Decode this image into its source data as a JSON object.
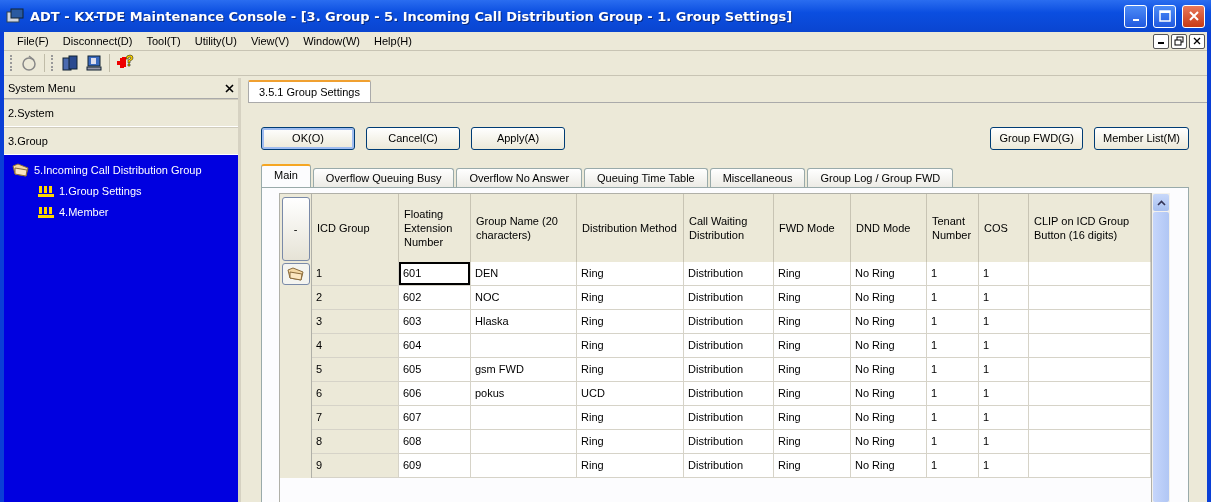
{
  "window": {
    "title": "ADT - KX-TDE Maintenance Console - [3. Group - 5. Incoming Call Distribution Group - 1. Group Settings]"
  },
  "menu": [
    "File(F)",
    "Disconnect(D)",
    "Tool(T)",
    "Utility(U)",
    "View(V)",
    "Window(W)",
    "Help(H)"
  ],
  "sidebar": {
    "title": "System Menu",
    "sections": [
      "2.System",
      "3.Group"
    ],
    "tree": [
      {
        "label": "5.Incoming Call Distribution Group",
        "children": [
          {
            "label": "1.Group Settings"
          },
          {
            "label": "4.Member"
          }
        ]
      }
    ]
  },
  "document_tab": {
    "label": "3.5.1 Group Settings",
    "selected": true
  },
  "buttons": [
    {
      "label": "OK(O)",
      "default": true
    },
    {
      "label": "Cancel(C)",
      "default": false
    },
    {
      "label": "Apply(A)",
      "default": false
    }
  ],
  "right_buttons": [
    "Group FWD(G)",
    "Member List(M)"
  ],
  "tabs": [
    {
      "label": "Main",
      "selected": true
    },
    {
      "label": "Overflow Queuing Busy",
      "selected": false
    },
    {
      "label": "Overflow No Answer",
      "selected": false
    },
    {
      "label": "Queuing Time Table",
      "selected": false
    },
    {
      "label": "Miscellaneous",
      "selected": false
    },
    {
      "label": "Group Log / Group FWD",
      "selected": false
    }
  ],
  "table": {
    "corner": "-",
    "columns": [
      "ICD Group",
      "Floating Extension Number",
      "Group Name (20 characters)",
      "Distribution Method",
      "Call Waiting Distribution",
      "FWD Mode",
      "DND Mode",
      "Tenant Number",
      "COS",
      "CLIP on ICD Group Button (16 digits)"
    ],
    "rows": [
      {
        "selected": true,
        "cells": [
          "1",
          "601",
          "DEN",
          "Ring",
          "Distribution",
          "Ring",
          "No Ring",
          "1",
          "1",
          ""
        ]
      },
      {
        "selected": false,
        "cells": [
          "2",
          "602",
          "NOC",
          "Ring",
          "Distribution",
          "Ring",
          "No Ring",
          "1",
          "1",
          ""
        ]
      },
      {
        "selected": false,
        "cells": [
          "3",
          "603",
          "Hlaska",
          "Ring",
          "Distribution",
          "Ring",
          "No Ring",
          "1",
          "1",
          ""
        ]
      },
      {
        "selected": false,
        "cells": [
          "4",
          "604",
          "",
          "Ring",
          "Distribution",
          "Ring",
          "No Ring",
          "1",
          "1",
          ""
        ]
      },
      {
        "selected": false,
        "cells": [
          "5",
          "605",
          "gsm FWD",
          "Ring",
          "Distribution",
          "Ring",
          "No Ring",
          "1",
          "1",
          ""
        ]
      },
      {
        "selected": false,
        "cells": [
          "6",
          "606",
          "pokus",
          "UCD",
          "Distribution",
          "Ring",
          "No Ring",
          "1",
          "1",
          ""
        ]
      },
      {
        "selected": false,
        "cells": [
          "7",
          "607",
          "",
          "Ring",
          "Distribution",
          "Ring",
          "No Ring",
          "1",
          "1",
          ""
        ]
      },
      {
        "selected": false,
        "cells": [
          "8",
          "608",
          "",
          "Ring",
          "Distribution",
          "Ring",
          "No Ring",
          "1",
          "1",
          ""
        ]
      },
      {
        "selected": false,
        "cells": [
          "9",
          "609",
          "",
          "Ring",
          "Distribution",
          "Ring",
          "No Ring",
          "1",
          "1",
          ""
        ]
      }
    ]
  }
}
